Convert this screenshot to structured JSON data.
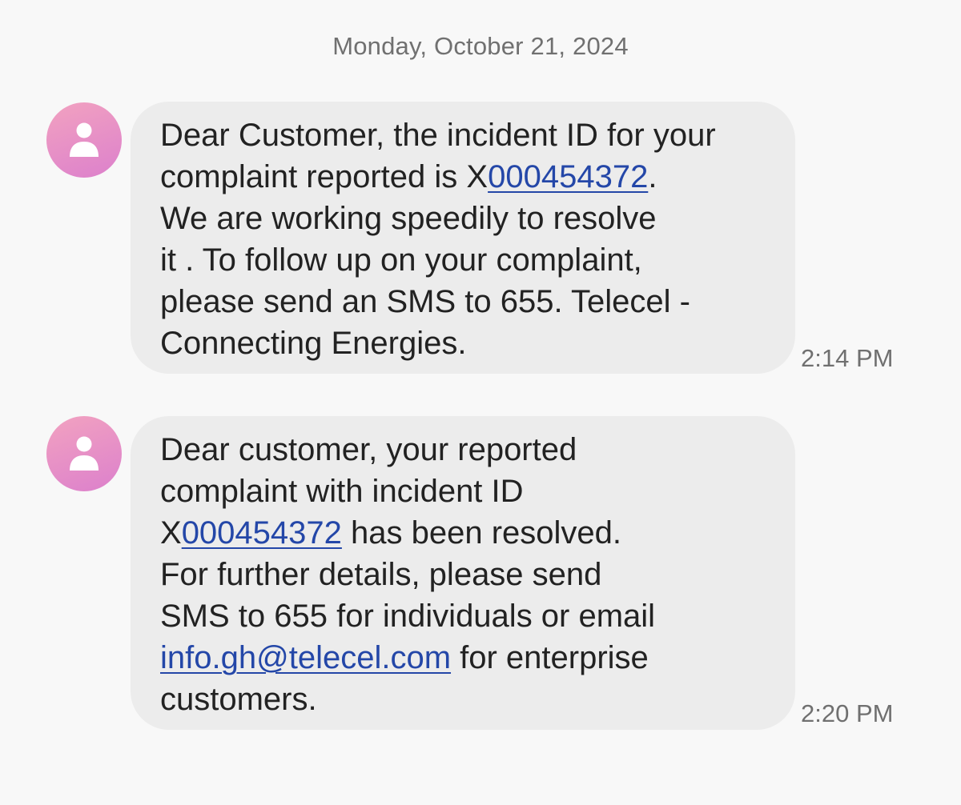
{
  "date_header": "Monday, October 21, 2024",
  "colors": {
    "background": "#f8f8f8",
    "bubble": "#ececec",
    "text": "#222222",
    "link": "#2447a8",
    "meta_text": "#707070",
    "avatar_gradient": [
      "#f2a2c0",
      "#dc80cc"
    ]
  },
  "messages": [
    {
      "avatar_icon": "person-icon",
      "time": "2:14 PM",
      "lines": [
        {
          "pre": "Dear Customer, the incident ID for your"
        },
        {
          "pre": "complaint reported is X",
          "link": "000454372",
          "post": "."
        },
        {
          "pre": "We are working speedily to resolve"
        },
        {
          "pre": "it . To follow up on your complaint,"
        },
        {
          "pre": "please send an SMS to 655. Telecel -"
        },
        {
          "pre": "Connecting Energies."
        }
      ]
    },
    {
      "avatar_icon": "person-icon",
      "time": "2:20 PM",
      "lines": [
        {
          "pre": "Dear customer, your reported"
        },
        {
          "pre": "complaint with incident ID"
        },
        {
          "pre": "X",
          "link": "000454372",
          "post": " has been resolved."
        },
        {
          "pre": "For further details, please send"
        },
        {
          "pre": "SMS to 655 for individuals or email"
        },
        {
          "pre": "",
          "link": "info.gh@telecel.com",
          "post": " for enterprise"
        },
        {
          "pre": "customers."
        }
      ]
    }
  ]
}
